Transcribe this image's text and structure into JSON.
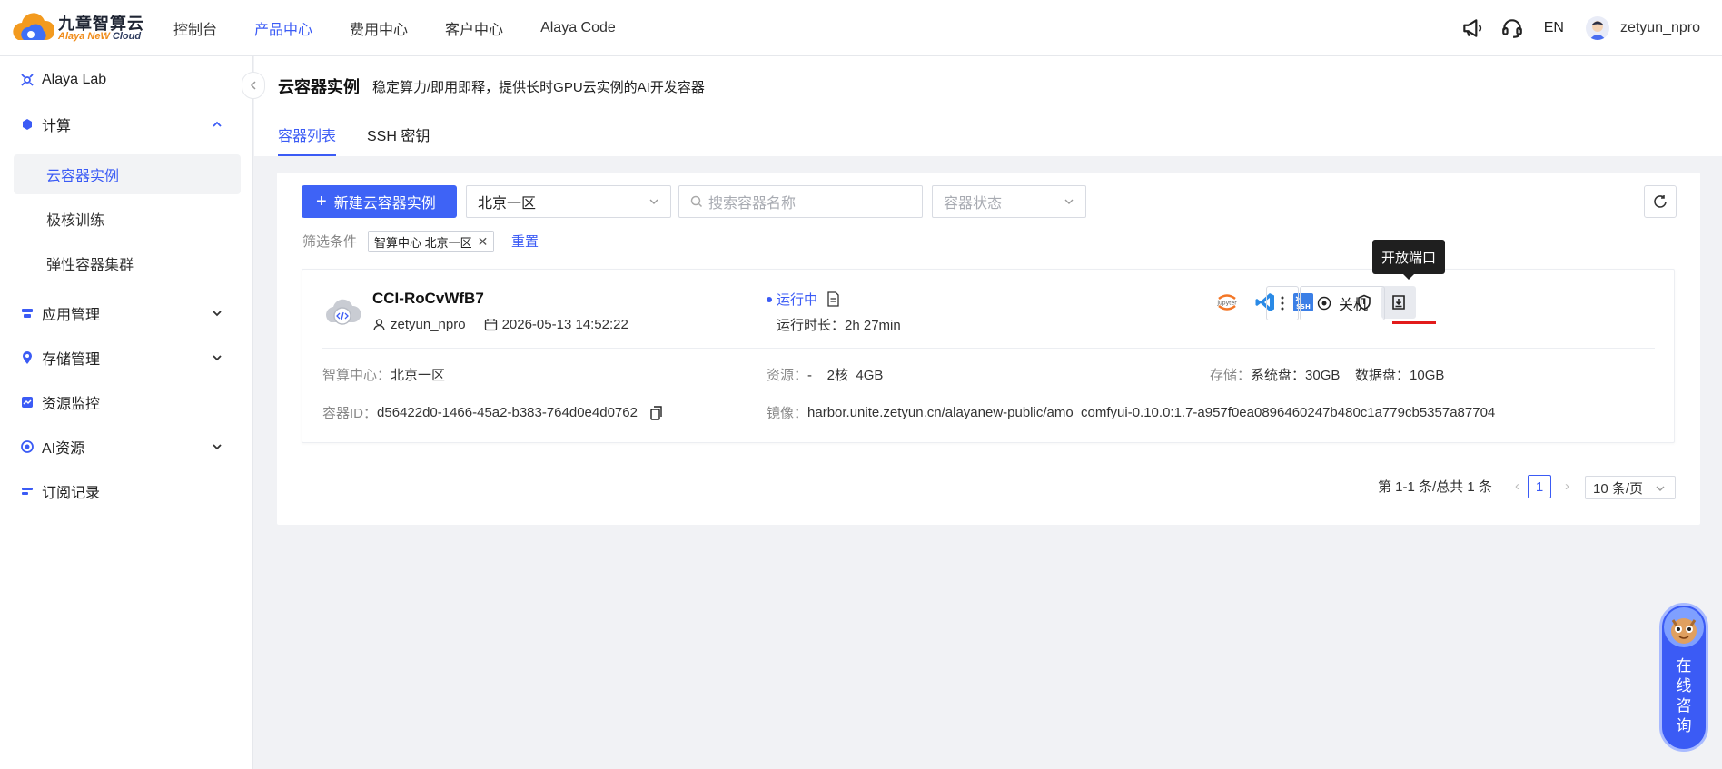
{
  "brand": {
    "title": "九章智算云",
    "sub_a": "Alaya NeW",
    "sub_b": " Cloud"
  },
  "topnav": [
    "控制台",
    "产品中心",
    "费用中心",
    "客户中心",
    "Alaya Code"
  ],
  "topnav_active": 1,
  "header_right": {
    "lang": "EN",
    "username": "zetyun_npro"
  },
  "sidebar": {
    "items": [
      {
        "label": "Alaya Lab",
        "icon": "lab-icon"
      },
      {
        "label": "计算",
        "icon": "compute-icon"
      },
      {
        "label": "应用管理",
        "icon": "app-icon"
      },
      {
        "label": "存储管理",
        "icon": "storage-icon"
      },
      {
        "label": "资源监控",
        "icon": "monitor-icon"
      },
      {
        "label": "AI资源",
        "icon": "ai-icon"
      },
      {
        "label": "订阅记录",
        "icon": "subscription-icon"
      }
    ],
    "sub_items": [
      "云容器实例",
      "极核训练",
      "弹性容器集群"
    ]
  },
  "page": {
    "title": "云容器实例",
    "desc": "稳定算力/即用即释，提供长时GPU云实例的AI开发容器",
    "tabs": [
      "容器列表",
      "SSH 密钥"
    ]
  },
  "toolbar": {
    "new_button": "新建云容器实例",
    "region": "北京一区",
    "search_placeholder": "搜索容器名称",
    "status_placeholder": "容器状态"
  },
  "filters": {
    "label": "筛选条件",
    "tag": "智算中心 北京一区",
    "reset": "重置"
  },
  "instance": {
    "name": "CCI-RoCvWfB7",
    "user": "zetyun_npro",
    "created": "2026-05-13 14:52:22",
    "status": "运行中",
    "runtime": "运行时长：2h 27min",
    "tooltip": "开放端口",
    "shutdown": "关机",
    "center_key": "智算中心：",
    "center_val": "北京一区",
    "res_key": "资源：",
    "res_val": "-    2核  4GB",
    "storage_key": "存储：",
    "storage_val": "系统盘：30GB    数据盘：10GB",
    "id_key": "容器ID：",
    "id_val": "d56422d0-1466-45a2-b383-764d0e4d0762",
    "image_key": "镜像：",
    "image_val": "harbor.unite.zetyun.cn/alayanew-public/amo_comfyui-0.10.0:1.7-a957f0ea0896460247b480c1a779cb5357a87704"
  },
  "pagination": {
    "summary": "第 1-1 条/总共 1 条",
    "current": "1",
    "page_size": "10 条/页"
  },
  "chat": {
    "label": "在线咨询"
  },
  "colors": {
    "accent": "#3b5bf5",
    "primary_button": "#3e63f6",
    "highlight": "#e21b1b"
  }
}
